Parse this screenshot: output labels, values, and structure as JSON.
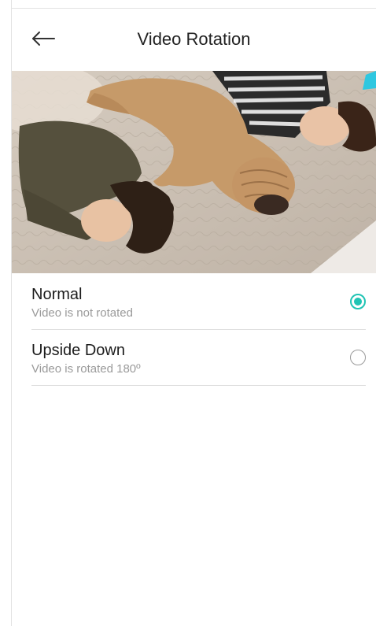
{
  "header": {
    "title": "Video Rotation",
    "back_icon": "arrow-left-icon"
  },
  "preview": {
    "description_icon": "camera-preview-image"
  },
  "options": [
    {
      "label": "Normal",
      "description": "Video is not rotated",
      "selected": true
    },
    {
      "label": "Upside Down",
      "description": "Video is rotated 180º",
      "selected": false
    }
  ],
  "colors": {
    "accent": "#20c4b4",
    "title": "#222222",
    "secondary_text": "#9a9a9a",
    "divider": "#dedede"
  }
}
